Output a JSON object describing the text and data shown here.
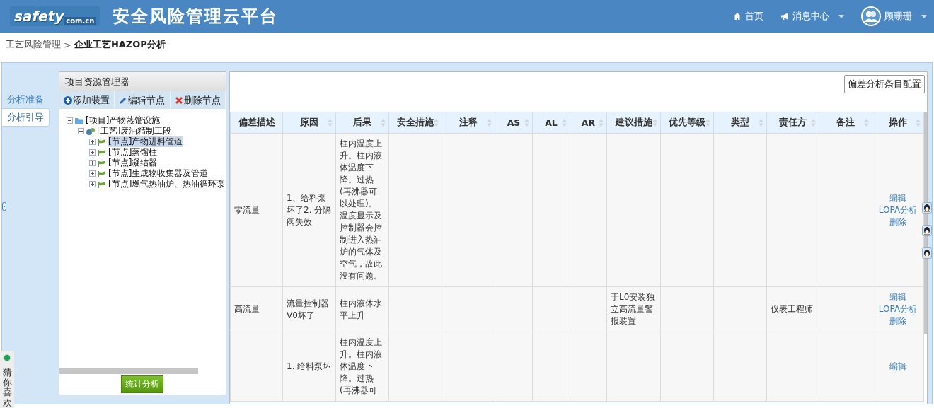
{
  "header": {
    "logo": {
      "brand": "safety",
      "domain": "com.cn"
    },
    "title": "安全风险管理云平台",
    "nav": [
      {
        "label": "首页",
        "dropdown": false
      },
      {
        "label": "消息中心",
        "dropdown": true
      }
    ],
    "user": {
      "name": "顾珊珊",
      "dropdown": true
    }
  },
  "breadcrumb": {
    "parent": "工艺风险管理",
    "separator": ">",
    "current": "企业工艺HAZOP分析"
  },
  "side_tabs": [
    {
      "label": "分析准备",
      "selected": false
    },
    {
      "label": "分析引导",
      "selected": true
    }
  ],
  "explorer": {
    "title": "项目资源管理器",
    "toolbar": [
      {
        "label": "添加装置"
      },
      {
        "label": "编辑节点"
      },
      {
        "label": "删除节点"
      }
    ],
    "tree": [
      {
        "label": "[项目]产物蒸馏设施",
        "kind": "project",
        "expanded": true,
        "selected": false,
        "children": [
          {
            "label": "[工艺]废油精制工段",
            "kind": "process",
            "expanded": true,
            "selected": false,
            "children": [
              {
                "label": "[节点]产物进料管道",
                "kind": "node",
                "expanded": false,
                "selected": true
              },
              {
                "label": "[节点]蒸馏柱",
                "kind": "node",
                "expanded": false,
                "selected": false
              },
              {
                "label": "[节点]凝结器",
                "kind": "node",
                "expanded": false,
                "selected": false
              },
              {
                "label": "[节点]生成物收集器及管道",
                "kind": "node",
                "expanded": false,
                "selected": false
              },
              {
                "label": "[节点]燃气热油炉、热油循环泵",
                "kind": "node",
                "expanded": false,
                "selected": false
              }
            ]
          }
        ]
      }
    ],
    "stats_button": "统计分析"
  },
  "table": {
    "config_button": "偏差分析条目配置",
    "columns": [
      {
        "label": "偏差描述",
        "sortable": false
      },
      {
        "label": "原因",
        "sortable": true
      },
      {
        "label": "后果",
        "sortable": true
      },
      {
        "label": "安全措施",
        "sortable": true
      },
      {
        "label": "注释",
        "sortable": true
      },
      {
        "label": "AS",
        "sortable": true
      },
      {
        "label": "AL",
        "sortable": true
      },
      {
        "label": "AR",
        "sortable": true
      },
      {
        "label": "建议措施",
        "sortable": true
      },
      {
        "label": "优先等级",
        "sortable": true
      },
      {
        "label": "类型",
        "sortable": true
      },
      {
        "label": "责任方",
        "sortable": true
      },
      {
        "label": "备注",
        "sortable": true
      },
      {
        "label": "操作",
        "sortable": true
      }
    ],
    "rows": [
      {
        "cells": [
          "零流量",
          "1、给料泵坏了2. 分隔阀失效",
          "柱内温度上升。柱内液体温度下降。过热(再沸器可以处理)。温度显示及控制器会控制进入热油炉的气体及空气，故此没有问题。",
          null,
          null,
          null,
          null,
          null,
          null,
          null,
          null,
          null,
          null
        ],
        "actions": [
          "编辑",
          "LOPA分析",
          "删除"
        ]
      },
      {
        "cells": [
          "高流量",
          "流量控制器V0坏了",
          "柱内液体水平上升",
          null,
          null,
          null,
          null,
          null,
          "于L0安装独立高流量警报装置",
          null,
          null,
          "仪表工程师",
          null
        ],
        "actions": [
          "编辑",
          "LOPA分析",
          "删除"
        ]
      },
      {
        "cells": [
          null,
          "1. 给料泵坏",
          "柱内温度上升。柱内液体温度下降。过热(再沸器可",
          null,
          null,
          null,
          null,
          null,
          null,
          null,
          null,
          null,
          null
        ],
        "actions": [
          "编辑"
        ]
      }
    ]
  },
  "float_widget": {
    "label": "猜你喜欢"
  }
}
